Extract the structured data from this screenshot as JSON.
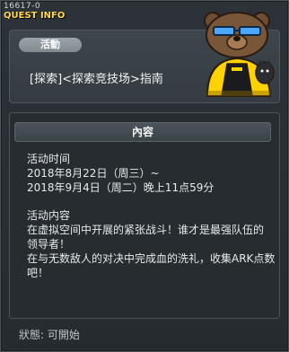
{
  "window": {
    "quest_id": "16617-0",
    "title": "QUEST INFO"
  },
  "header": {
    "category_badge": "活動",
    "guide_title": "[探索]<探索竞技场>指南"
  },
  "content": {
    "section_title": "內容",
    "lines": [
      "活动时间",
      "2018年8月22日（周三）~",
      "2018年9月4日（周二）晚上11点59分",
      "",
      "活动内容",
      "在虚拟空间中开展的紧张战斗！谁才是最强队伍的",
      "领导者！",
      "在与无数敌人的对决中完成血的洗礼，收集ARK点数",
      "吧！"
    ]
  },
  "footer": {
    "status_text": "狀態: 可開始"
  },
  "icons": {
    "mascot": "bear-mascot-icon"
  },
  "colors": {
    "title": "#ffd84a",
    "badge": "#9aa3a8",
    "background": "#2c3338"
  }
}
